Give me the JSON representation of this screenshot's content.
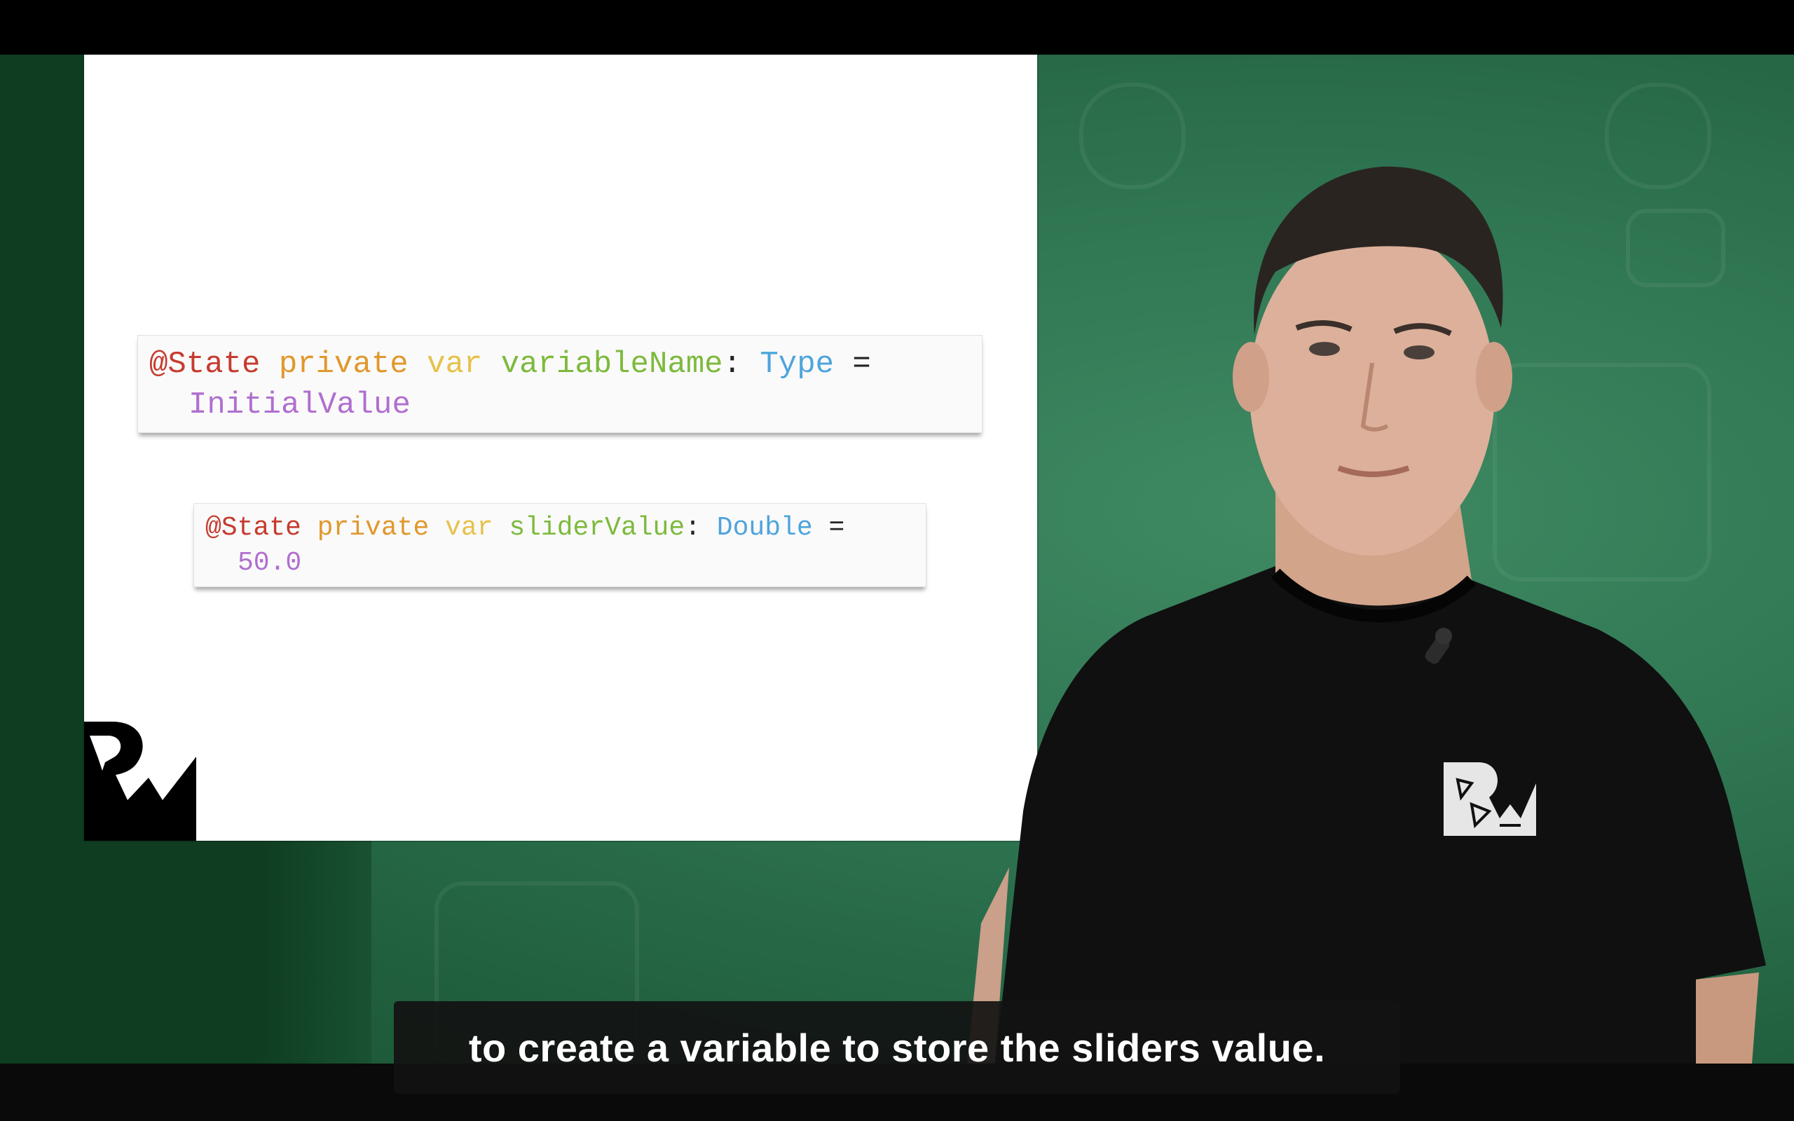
{
  "video": {
    "caption": "to create a variable to store the sliders value."
  },
  "slide": {
    "code_general": {
      "kw_state": "@State",
      "kw_private": "private",
      "kw_var": "var",
      "name": "variableName",
      "colon": ":",
      "type": "Type",
      "equals": "=",
      "value": "InitialValue"
    },
    "code_example": {
      "kw_state": "@State",
      "kw_private": "private",
      "kw_var": "var",
      "name": "sliderValue",
      "colon": ":",
      "type": "Double",
      "equals": "=",
      "value": "50.0"
    },
    "syntax_colors": {
      "attribute": "#c63b2f",
      "modifier": "#e0982c",
      "keyword": "#e6c24a",
      "identifier": "#7dba3c",
      "type": "#4ea4dd",
      "value": "#b06fcf",
      "plain": "#222222"
    }
  },
  "icons": {
    "logo": "raywenderlich-logo",
    "shirt_logo": "raywenderlich-logo",
    "mic": "lapel-microphone-icon"
  }
}
